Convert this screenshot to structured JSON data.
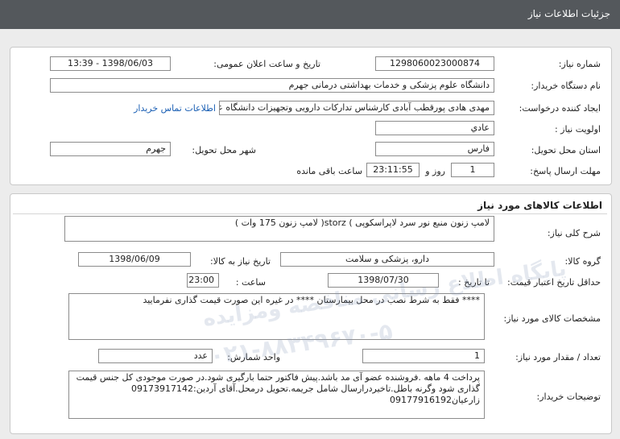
{
  "header": {
    "title": "جزئیات اطلاعات نیاز"
  },
  "info": {
    "need_number_label": "شماره نیاز:",
    "need_number": "1298060023000874",
    "announce_label": "تاریخ و ساعت اعلان عمومی:",
    "announce_value": "1398/06/03 - 13:39",
    "buyer_org_label": "نام دستگاه خریدار:",
    "buyer_org": "دانشگاه علوم پزشکی و خدمات بهداشتی درمانی جهرم",
    "creator_label": "ایجاد کننده درخواست:",
    "creator": "مهدی هادی پورقطب آبادی کارشناس تدارکات دارویی وتجهیزات دانشگاه علوم پز",
    "contact_link": "اطلاعات تماس خریدار",
    "priority_label": "اولویت نیاز :",
    "priority": "عادي",
    "province_label": "استان محل تحویل:",
    "province": "فارس",
    "city_label": "شهر محل تحویل:",
    "city": "جهرم",
    "deadline_label": "مهلت ارسال پاسخ:",
    "days": "1",
    "days_word": "روز و",
    "time_left": "23:11:55",
    "remaining_text": "ساعت باقی مانده"
  },
  "goods": {
    "section_title": "اطلاعات کالاهای مورد نیاز",
    "desc_label": "شرح کلی نیاز:",
    "desc": "لامپ زنون منبع نور سرد لاپراسکوپی ) storz( لامپ زنون 175 وات )",
    "group_label": "گروه کالا:",
    "group": "دارو، پزشکی و سلامت",
    "need_date_label": "تاریخ نیاز به کالا:",
    "need_date": "1398/06/09",
    "validity_label": "حداقل تاریخ اعتبار قیمت:",
    "to_date_label": "تا تاریخ :",
    "validity_date": "1398/07/30",
    "hour_label": "ساعت :",
    "validity_time": "23:00",
    "specs_label": "مشخصات کالای مورد نیاز:",
    "specs": "**** فقط به شرط نصب در محل بیمارستان **** در غیره این صورت قیمت گذاری نفرمایید",
    "qty_label": "تعداد / مقدار مورد نیاز:",
    "qty": "1",
    "unit_label": "واحد شمارش:",
    "unit": "عدد",
    "buyer_notes_label": "توضیحات خریدار:",
    "buyer_notes": "پرداخت 4 ماهه .فروشنده عضو آی مد باشد.پیش فاکتور حتما بارگیری شود.در صورت موجودی کل جنس قیمت گذاری شود وگرنه باطل.تاخیردرارسال شامل جریمه.تحویل درمحل.آقای آردین:09173917142 زارعیان09177916192"
  },
  "watermark": {
    "line1": "پایگاه اطلاع رسانی مناقصه ومزایده",
    "line2": "۰۲۱-۸۸۳۴۹۶۷۰-۵"
  }
}
